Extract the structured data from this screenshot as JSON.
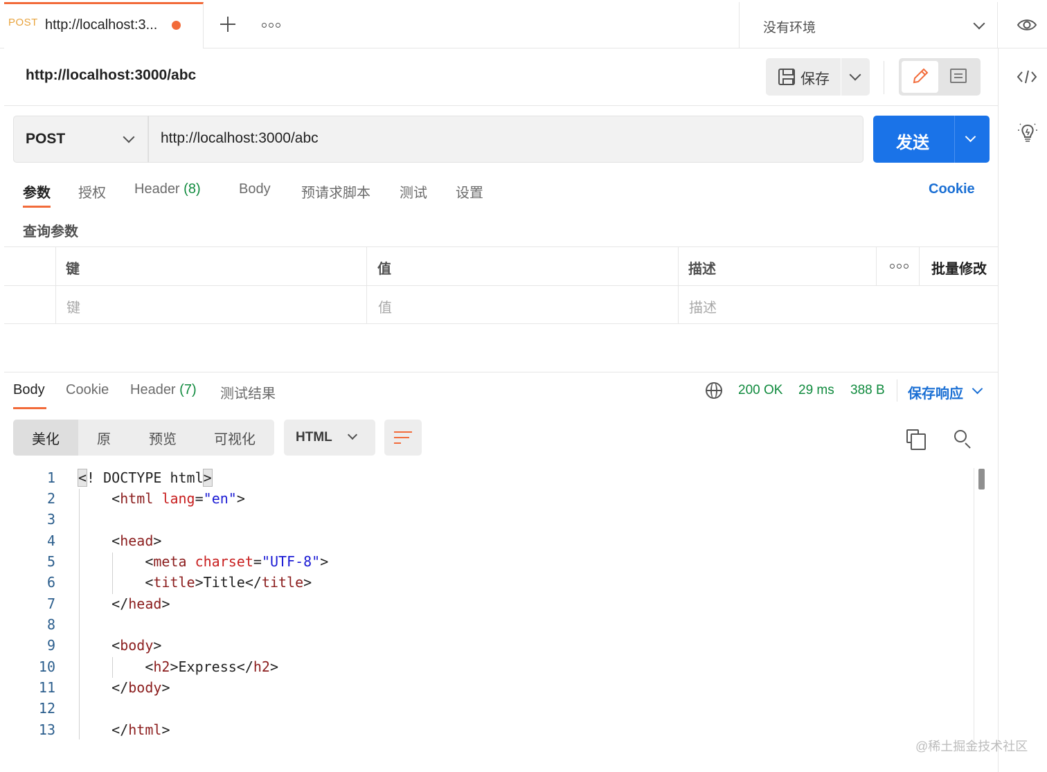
{
  "tabs": {
    "active": {
      "method": "POST",
      "title": "http://localhost:3..."
    }
  },
  "environment": {
    "selected": "没有环境"
  },
  "request": {
    "title": "http://localhost:3000/abc",
    "save_label": "保存",
    "method": "POST",
    "url": "http://localhost:3000/abc",
    "send_label": "发送",
    "tabs": [
      {
        "label": "参数"
      },
      {
        "label": "授权"
      },
      {
        "label": "Header",
        "count": "(8)"
      },
      {
        "label": "Body"
      },
      {
        "label": "预请求脚本"
      },
      {
        "label": "测试"
      },
      {
        "label": "设置"
      }
    ],
    "cookie_link": "Cookie",
    "query_params": {
      "title": "查询参数",
      "headers": {
        "key": "键",
        "value": "值",
        "description": "描述",
        "bulk_edit": "批量修改"
      },
      "placeholders": {
        "key": "键",
        "value": "值",
        "description": "描述"
      }
    }
  },
  "response": {
    "tabs": [
      {
        "label": "Body"
      },
      {
        "label": "Cookie"
      },
      {
        "label": "Header",
        "count": "(7)"
      },
      {
        "label": "测试结果"
      }
    ],
    "status": "200 OK",
    "time": "29 ms",
    "size": "388 B",
    "save_response": "保存响应",
    "formats": [
      "美化",
      "原",
      "预览",
      "可视化"
    ],
    "language": "HTML",
    "code_line_numbers": [
      "1",
      "2",
      "3",
      "4",
      "5",
      "6",
      "7",
      "8",
      "9",
      "10",
      "11",
      "12",
      "13"
    ]
  },
  "watermark": "@稀土掘金技术社区",
  "colors": {
    "accent_orange": "#f26b3a",
    "primary_blue": "#1a73e8",
    "status_green": "#0f8a3d",
    "link_blue": "#1a6fd4"
  }
}
